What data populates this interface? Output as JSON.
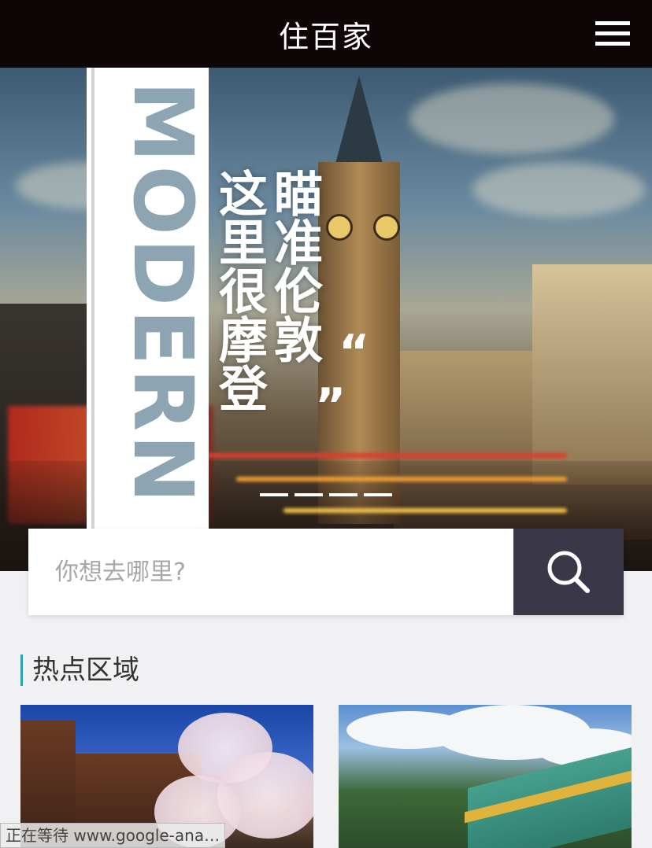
{
  "header": {
    "title": "住百家",
    "menu_icon": "hamburger-menu-icon"
  },
  "banner": {
    "vertical_word": "MODERN",
    "slogan_col1": "这里很摩登",
    "slogan_col2": "瞄准伦敦",
    "quote_open": "“",
    "quote_close": "”",
    "slide_count": 4,
    "active_slide": 1
  },
  "search": {
    "placeholder": "你想去哪里?",
    "button_icon": "search-icon"
  },
  "hot_areas": {
    "title": "热点区域",
    "accent_color": "#2aa1a8",
    "cards": [
      {
        "image": "kyoto-cherry-blossom"
      },
      {
        "image": "taipei-palace-museum"
      }
    ]
  },
  "status": {
    "loading": "正在等待 www.google-ana…"
  },
  "colors": {
    "topbar": "#0e0506",
    "search_button": "#3a3848",
    "page_bg": "#f1f1f3"
  }
}
